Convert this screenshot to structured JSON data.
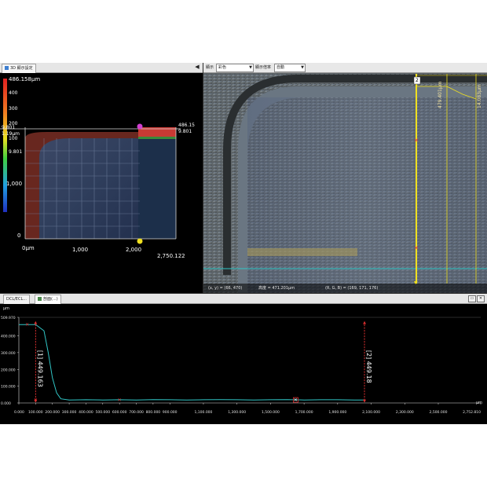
{
  "left_panel": {
    "tab_label": "3D 顯示設定",
    "scale": {
      "max_label": "486.158μm",
      "ticks": [
        "400",
        "300",
        "200",
        "100"
      ],
      "min_label": "9.801"
    },
    "model": {
      "x_axis": [
        "0μm",
        "1,000",
        "2,000",
        "2,750.122"
      ],
      "z_axis": [
        "1,000",
        "0"
      ],
      "top_left_value": "9.801",
      "top_left_value_2": "1.19μm",
      "top_right_value": "486.15",
      "top_right_value_2": "9.801"
    }
  },
  "right_panel": {
    "toolbar": {
      "label1": "顯示",
      "select1": "彩色",
      "label2": "顯示倍率",
      "select2": "自動"
    },
    "overlay": {
      "marker": "2",
      "measure_1": "479.401μm",
      "measure_2": "14.083μm"
    },
    "status": {
      "xy": "(x, y) = (66, 470)",
      "height": "高度 = 471.201μm",
      "rgb": "(R, G, B) = (169, 171, 176)"
    }
  },
  "bottom_panel": {
    "tabs": [
      "DCL/ECL...",
      "剖面(...)"
    ],
    "window_buttons": [
      "▭",
      "✕"
    ],
    "y_unit": "μm",
    "x_unit": "μm",
    "y_ticks": [
      "509.970",
      "400.000",
      "300.000",
      "200.000",
      "100.000",
      "0.000"
    ],
    "x_ticks": [
      "0.000",
      "100.000",
      "200.000",
      "300.000",
      "400.000",
      "500.000",
      "600.000",
      "700.000",
      "800.000",
      "900.000",
      "1,100.000",
      "1,300.000",
      "1,500.000",
      "1,700.000",
      "1,900.000",
      "2,100.000",
      "2,300.000",
      "2,500.000",
      "2,752.810"
    ],
    "measure_1": "[1] 449.163",
    "measure_2": "[2] 449.18"
  },
  "chart_data": {
    "type": "line",
    "xlabel": "μm",
    "ylabel": "μm",
    "xlim": [
      0,
      2752.81
    ],
    "ylim": [
      0,
      509.97
    ],
    "series": [
      {
        "x": [
          0,
          100,
          150,
          175,
          200,
          225,
          250,
          300,
          400,
          500,
          600,
          700,
          800,
          900,
          1000,
          1100,
          1200,
          1300,
          1400,
          1500,
          1600,
          1700,
          1800,
          1900,
          2000,
          2060
        ],
        "y": [
          467,
          467,
          430,
          300,
          150,
          60,
          25,
          18,
          19,
          18,
          19,
          18,
          20,
          19,
          18,
          19,
          20,
          19,
          18,
          19,
          20,
          18,
          19,
          19,
          18,
          18
        ]
      }
    ],
    "colors": {
      "profile": "#31c6c6",
      "measure": "#e03030",
      "axis": "#e0e0e0"
    }
  }
}
